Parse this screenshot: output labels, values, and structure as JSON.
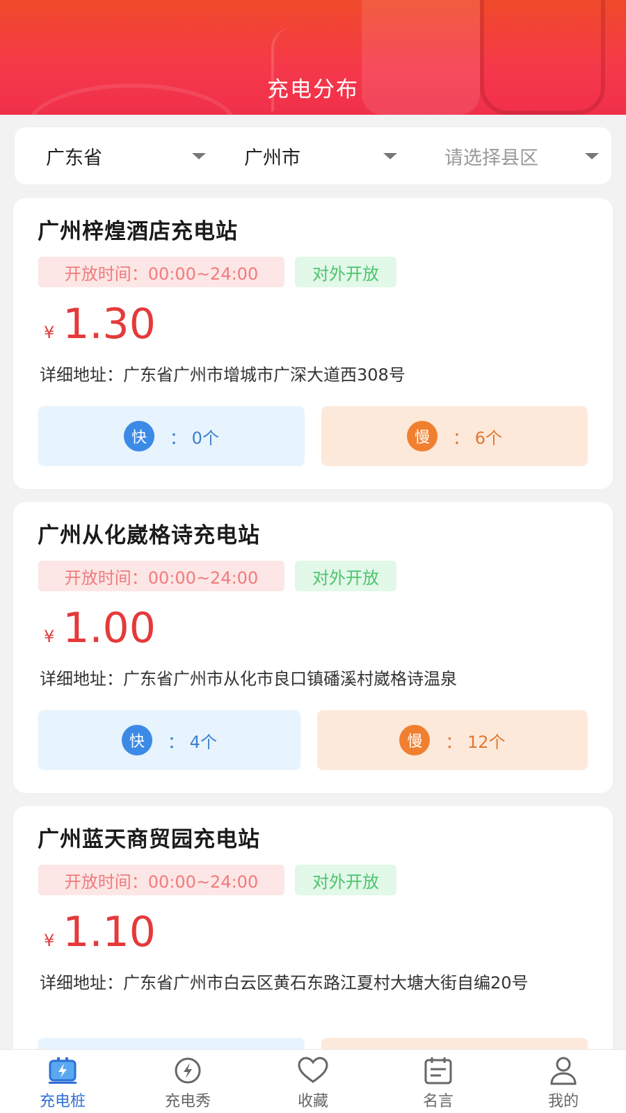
{
  "header": {
    "title": "充电分布"
  },
  "filters": {
    "province": "广东省",
    "city": "广州市",
    "district_placeholder": "请选择县区"
  },
  "stations": [
    {
      "name": "广州梓煌酒店充电站",
      "hours": "开放时间：00:00~24:00",
      "status": "对外开放",
      "currency": "¥",
      "price": "1.30",
      "address": "详细地址：广东省广州市增城市广深大道西308号",
      "fast_label": "快",
      "fast_count": "：  0个",
      "slow_label": "慢",
      "slow_count": "：  6个"
    },
    {
      "name": "广州从化崴格诗充电站",
      "hours": "开放时间：00:00~24:00",
      "status": "对外开放",
      "currency": "¥",
      "price": "1.00",
      "address": "详细地址：广东省广州市从化市良口镇磻溪村崴格诗温泉",
      "fast_label": "快",
      "fast_count": "：  4个",
      "slow_label": "慢",
      "slow_count": "：  12个"
    },
    {
      "name": "广州蓝天商贸园充电站",
      "hours": "开放时间：00:00~24:00",
      "status": "对外开放",
      "currency": "¥",
      "price": "1.10",
      "address": "详细地址：广东省广州市白云区黄石东路江夏村大塘大街自编20号"
    }
  ],
  "nav": [
    {
      "label": "充电桩",
      "icon": "charging-pile-icon"
    },
    {
      "label": "充电秀",
      "icon": "lightning-icon"
    },
    {
      "label": "收藏",
      "icon": "heart-icon"
    },
    {
      "label": "名言",
      "icon": "calendar-icon"
    },
    {
      "label": "我的",
      "icon": "user-icon"
    }
  ],
  "colors": {
    "header": "#f5384a",
    "price": "#e53a3a",
    "fast": "#3b8ae6",
    "slow": "#f08030",
    "active_nav": "#2f6fd6"
  }
}
